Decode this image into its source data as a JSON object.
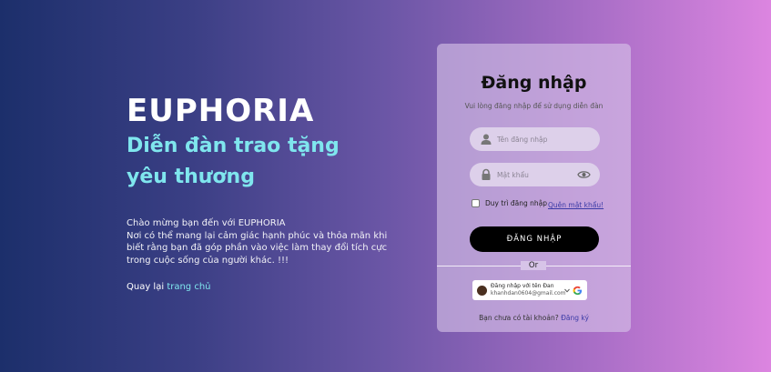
{
  "left": {
    "brand": "EUPHORIA",
    "tagline": "Diễn đàn trao tặng yêu thương",
    "welcome": "Chào mừng bạn đến với EUPHORIA",
    "description": "Nơi có thể mang lại cảm giác hạnh phúc và thỏa mãn khi biết rằng bạn đã góp phần vào việc làm thay đổi tích cực trong cuộc sống của người khác. !!!",
    "back_prefix": "Quay lại",
    "back_link": "trang chủ"
  },
  "login": {
    "title": "Đăng nhập",
    "subtitle": "Vui lòng đăng nhập để sử dụng diễn đàn",
    "username_placeholder": "Tên đăng nhập",
    "password_placeholder": "Mật khẩu",
    "remember_label": "Duy trì đăng nhập",
    "forgot_label": "Quên mật khẩu!",
    "button_label": "ĐĂNG NHẬP",
    "or_label": "Or",
    "google_line1": "Đăng nhập với tên Đan",
    "google_line2": "khanhdan0604@gmail.com",
    "signup_prefix": "Bạn chưa có tài khoản?",
    "signup_link": "Đăng ký"
  },
  "colors": {
    "accent": "#7fe6ee",
    "link": "#3b3aa6",
    "button": "#000000"
  },
  "icons": [
    "user-icon",
    "lock-icon",
    "eye-icon",
    "google-icon",
    "chevron-down-icon"
  ]
}
